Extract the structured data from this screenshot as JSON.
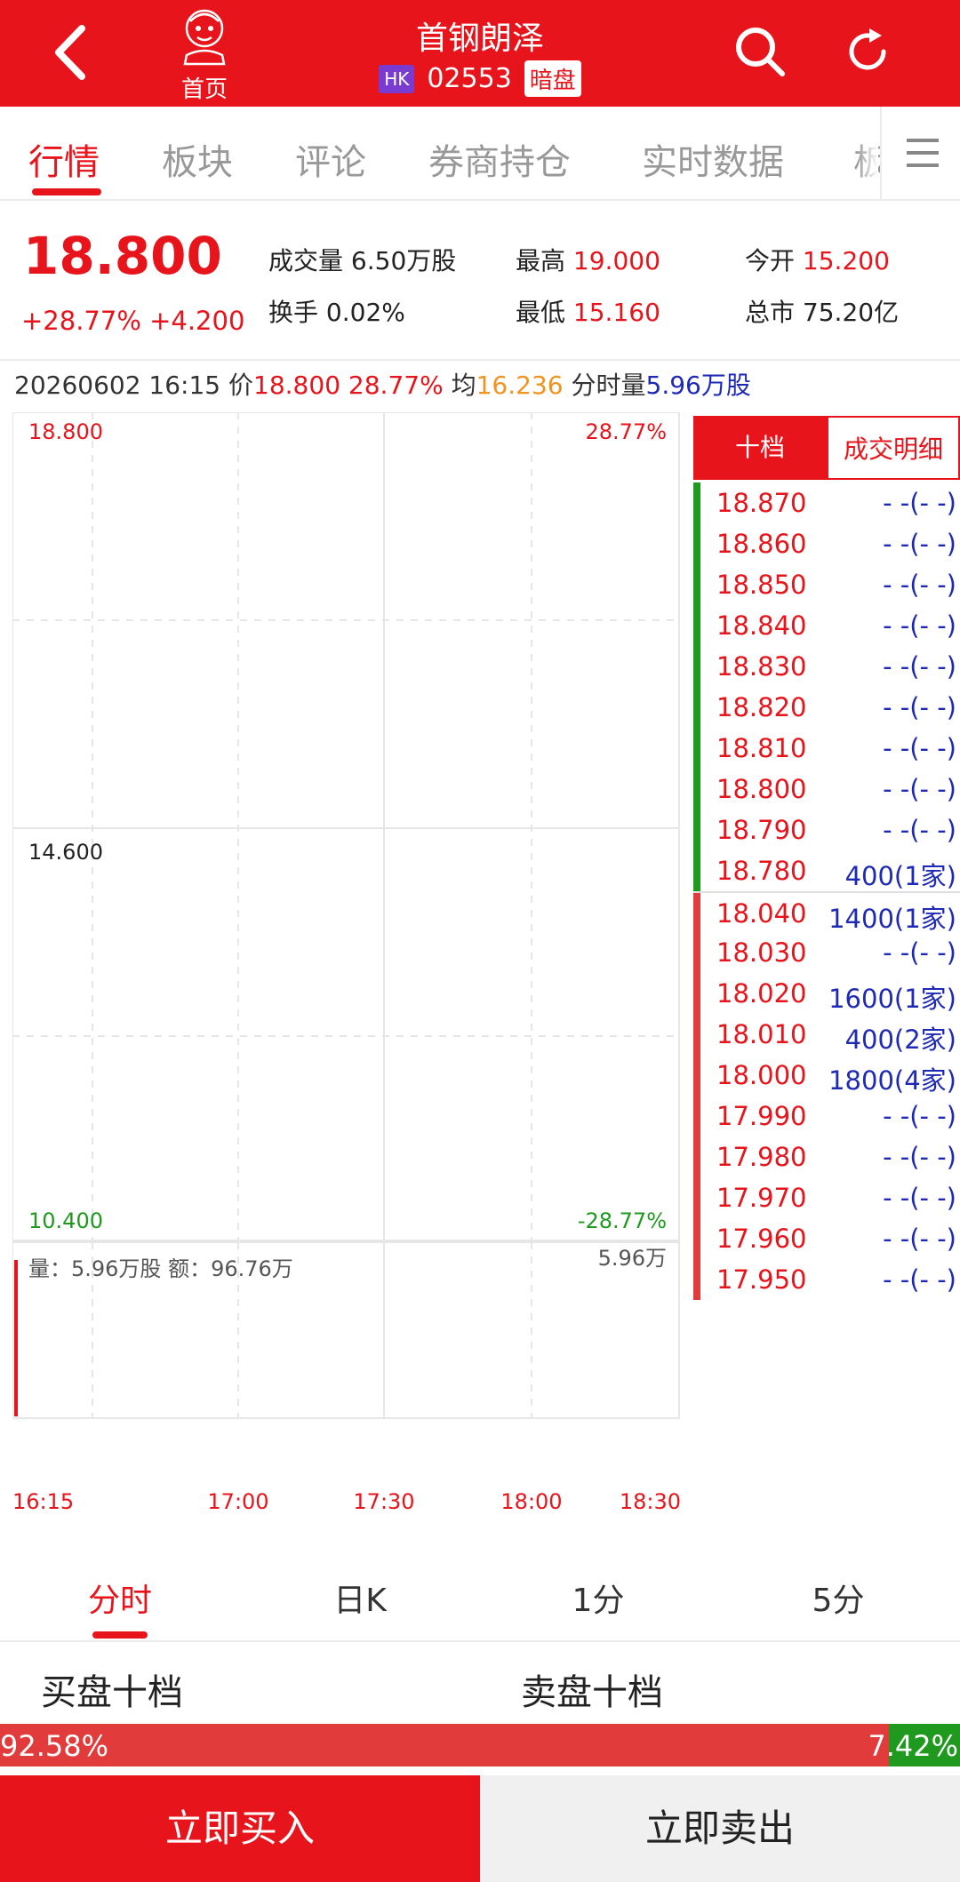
{
  "header": {
    "home_label": "首页",
    "title": "首钢朗泽",
    "market_badge": "HK",
    "code": "02553",
    "session_badge": "暗盘"
  },
  "tabs": [
    {
      "label": "行情",
      "active": true
    },
    {
      "label": "板块",
      "active": false
    },
    {
      "label": "评论",
      "active": false
    },
    {
      "label": "券商持仓",
      "active": false
    },
    {
      "label": "实时数据",
      "active": false
    },
    {
      "label": "板",
      "active": false
    }
  ],
  "quote": {
    "price": "18.800",
    "change": "+28.77% +4.200",
    "volume_label": "成交量",
    "volume": "6.50万股",
    "high_label": "最高",
    "high": "19.000",
    "open_label": "今开",
    "open": "15.200",
    "turnover_label": "换手",
    "turnover": "0.02%",
    "low_label": "最低",
    "low": "15.160",
    "mktcap_label": "总市",
    "mktcap": "75.20亿"
  },
  "info_line": {
    "datetime": "20260602 16:15",
    "price_label": "价",
    "price": "18.800",
    "pct": "28.77%",
    "avg_label": "均",
    "avg": "16.236",
    "vol_label": "分时量",
    "vol": "5.96万股"
  },
  "chart_data": {
    "type": "line",
    "price_axis": {
      "top": "18.800",
      "mid": "14.600",
      "bottom": "10.400"
    },
    "pct_axis": {
      "top": "28.77%",
      "bottom": "-28.77%"
    },
    "volume_label": "量：5.96万股 额：96.76万",
    "volume_max": "5.96万",
    "x_ticks": [
      "16:15",
      "17:00",
      "17:30",
      "18:00",
      "18:30"
    ],
    "volume_bars": [
      {
        "x": "16:15",
        "value": 5.96
      }
    ],
    "ylim": [
      10.4,
      18.8
    ],
    "grid": true
  },
  "orderbook": {
    "tab_active": "十档",
    "tab_inactive": "成交明细",
    "asks": [
      {
        "price": "18.870",
        "qty": "- -(- -)"
      },
      {
        "price": "18.860",
        "qty": "- -(- -)"
      },
      {
        "price": "18.850",
        "qty": "- -(- -)"
      },
      {
        "price": "18.840",
        "qty": "- -(- -)"
      },
      {
        "price": "18.830",
        "qty": "- -(- -)"
      },
      {
        "price": "18.820",
        "qty": "- -(- -)"
      },
      {
        "price": "18.810",
        "qty": "- -(- -)"
      },
      {
        "price": "18.800",
        "qty": "- -(- -)"
      },
      {
        "price": "18.790",
        "qty": "- -(- -)"
      },
      {
        "price": "18.780",
        "qty": "400(1家)"
      }
    ],
    "bids": [
      {
        "price": "18.040",
        "qty": "1400(1家)"
      },
      {
        "price": "18.030",
        "qty": "- -(- -)"
      },
      {
        "price": "18.020",
        "qty": "1600(1家)"
      },
      {
        "price": "18.010",
        "qty": "400(2家)"
      },
      {
        "price": "18.000",
        "qty": "1800(4家)"
      },
      {
        "price": "17.990",
        "qty": "- -(- -)"
      },
      {
        "price": "17.980",
        "qty": "- -(- -)"
      },
      {
        "price": "17.970",
        "qty": "- -(- -)"
      },
      {
        "price": "17.960",
        "qty": "- -(- -)"
      },
      {
        "price": "17.950",
        "qty": "- -(- -)"
      }
    ]
  },
  "period_tabs": [
    {
      "label": "分时",
      "active": true
    },
    {
      "label": "日K",
      "active": false
    },
    {
      "label": "1分",
      "active": false
    },
    {
      "label": "5分",
      "active": false
    }
  ],
  "book_heads": {
    "buy": "买盘十档",
    "sell": "卖盘十档"
  },
  "ratio": {
    "buy_pct": 92.58,
    "buy_label": "92.58%",
    "sell_label": "7.42%"
  },
  "actions": {
    "buy": "立即买入",
    "sell": "立即卖出"
  },
  "colors": {
    "brand": "#e8141b",
    "up": "#e8141b",
    "down": "#1f9a1f",
    "qty": "#1e2ab5",
    "avg": "#f0941f"
  }
}
